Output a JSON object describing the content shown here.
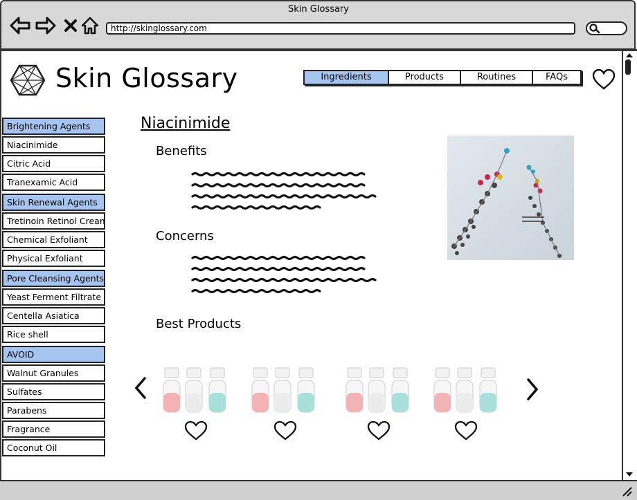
{
  "window": {
    "title": "Skin Glossary",
    "url": "http://skinglossary.com"
  },
  "header": {
    "site_title": "Skin Glossary",
    "nav": [
      {
        "label": "Ingredients",
        "active": true
      },
      {
        "label": "Products",
        "active": false
      },
      {
        "label": "Routines",
        "active": false
      },
      {
        "label": "FAQs",
        "active": false
      }
    ]
  },
  "sidebar": {
    "items": [
      {
        "label": "Brightening Agents",
        "header": true
      },
      {
        "label": "Niacinimide",
        "header": false
      },
      {
        "label": "Citric Acid",
        "header": false
      },
      {
        "label": "Tranexamic Acid",
        "header": false
      },
      {
        "label": "Skin Renewal Agents",
        "header": true
      },
      {
        "label": "Tretinoin Retinol Cream",
        "header": false
      },
      {
        "label": "Chemical Exfoliant",
        "header": false
      },
      {
        "label": "Physical Exfoliant",
        "header": false
      },
      {
        "label": "Pore Cleansing Agents",
        "header": true
      },
      {
        "label": "Yeast Ferment Filtrate",
        "header": false
      },
      {
        "label": "Centella Asiatica",
        "header": false
      },
      {
        "label": "Rice shell",
        "header": false
      },
      {
        "label": "AVOID",
        "header": true
      },
      {
        "label": "Walnut Granules",
        "header": false
      },
      {
        "label": "Sulfates",
        "header": false
      },
      {
        "label": "Parabens",
        "header": false
      },
      {
        "label": "Fragrance",
        "header": false
      },
      {
        "label": "Coconut Oil",
        "header": false
      }
    ]
  },
  "main": {
    "title": "Niacinimide",
    "benefits_heading": "Benefits",
    "concerns_heading": "Concerns",
    "best_products_heading": "Best Products"
  },
  "colors": {
    "accent": "#a5c4ef",
    "chrome": "#d8d8d8",
    "ink": "#222222"
  },
  "icons": [
    "back-arrow-icon",
    "forward-arrow-icon",
    "close-icon",
    "home-icon",
    "search-icon",
    "heart-icon",
    "chevron-left-icon",
    "chevron-right-icon",
    "logo-icon"
  ]
}
